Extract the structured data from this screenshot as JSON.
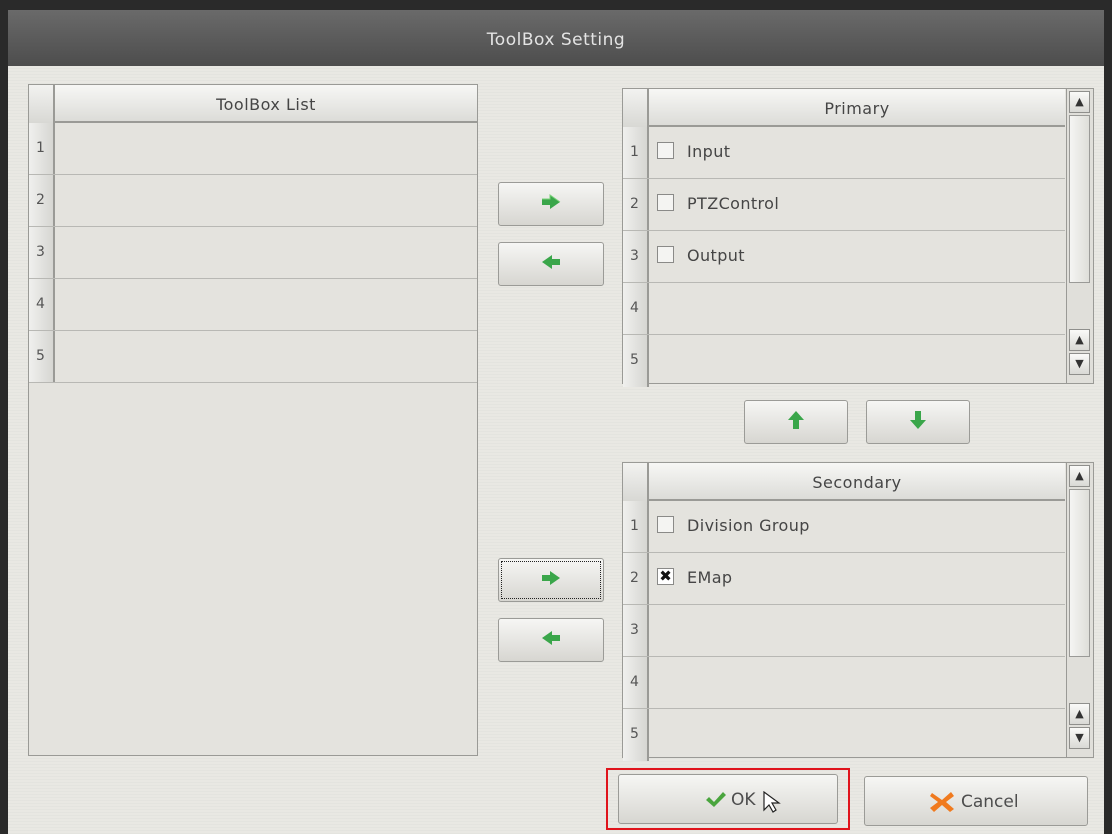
{
  "window": {
    "title": "ToolBox Setting"
  },
  "toolbox_list": {
    "header": "ToolBox List",
    "rows": [
      {
        "num": "1",
        "label": ""
      },
      {
        "num": "2",
        "label": ""
      },
      {
        "num": "3",
        "label": ""
      },
      {
        "num": "4",
        "label": ""
      },
      {
        "num": "5",
        "label": ""
      }
    ]
  },
  "primary": {
    "header": "Primary",
    "rows": [
      {
        "num": "1",
        "label": "Input",
        "checked": false
      },
      {
        "num": "2",
        "label": "PTZControl",
        "checked": false
      },
      {
        "num": "3",
        "label": "Output",
        "checked": false
      },
      {
        "num": "4",
        "label": "",
        "checked": false
      },
      {
        "num": "5",
        "label": "",
        "checked": false
      }
    ]
  },
  "secondary": {
    "header": "Secondary",
    "rows": [
      {
        "num": "1",
        "label": "Division Group",
        "checked": false
      },
      {
        "num": "2",
        "label": "EMap",
        "checked": true
      },
      {
        "num": "3",
        "label": "",
        "checked": false
      },
      {
        "num": "4",
        "label": "",
        "checked": false
      },
      {
        "num": "5",
        "label": "",
        "checked": false
      }
    ]
  },
  "buttons": {
    "ok_label": "OK",
    "cancel_label": "Cancel",
    "move_right_icon": "green-arrow-right-icon",
    "move_left_icon": "green-arrow-left-icon",
    "move_up_icon": "green-arrow-up-icon",
    "move_down_icon": "green-arrow-down-icon"
  },
  "check_mark": "✖",
  "colors": {
    "arrow": "#3aa64a",
    "ok_check": "#4aa53e",
    "cancel_x": "#f07a1e",
    "highlight": "#e0141c",
    "titlebar": "#555555"
  }
}
